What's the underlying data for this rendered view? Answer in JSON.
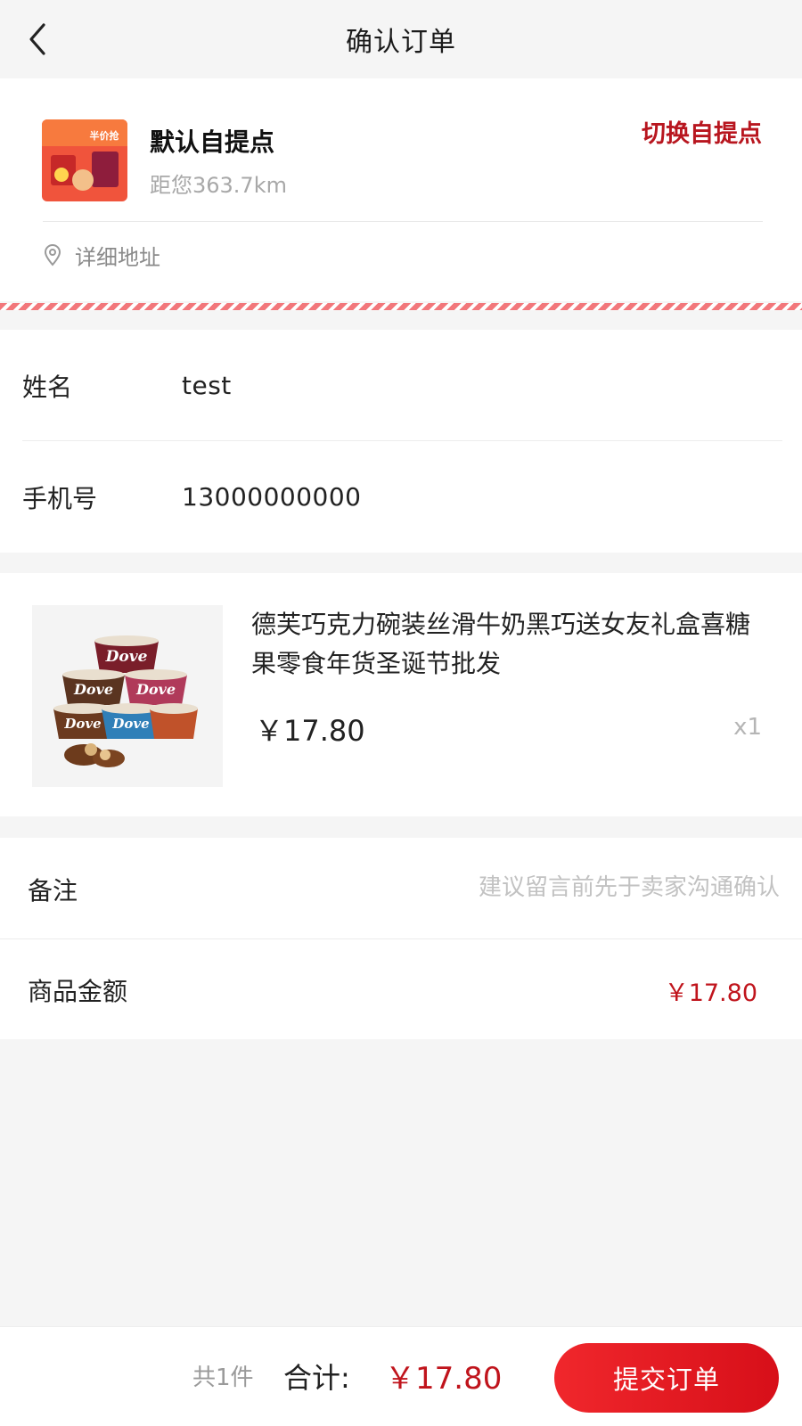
{
  "header": {
    "title": "确认订单",
    "back_icon": "chevron-left-icon"
  },
  "pickup": {
    "store_name": "默认自提点",
    "distance": "距您363.7km",
    "switch_label": "切换自提点",
    "address_icon": "location-pin-icon",
    "address_label": "详细地址",
    "thumb_text": "半价抢"
  },
  "contact": {
    "name_label": "姓名",
    "name_value": "test",
    "phone_label": "手机号",
    "phone_value": "13000000000"
  },
  "product": {
    "title": "德芙巧克力碗装丝滑牛奶黑巧送女友礼盒喜糖果零食年货圣诞节批发",
    "price": "￥17.80",
    "quantity": "x1",
    "brand_text": "Dove"
  },
  "remark": {
    "label": "备注",
    "placeholder": "建议留言前先于卖家沟通确认"
  },
  "amount": {
    "label": "商品金额",
    "value": "￥17.80"
  },
  "footer": {
    "count_text": "共1件",
    "total_label": "合计:",
    "total_value": "￥17.80",
    "submit_label": "提交订单"
  },
  "colors": {
    "accent": "#c0141c",
    "button": "#e61f24",
    "background": "#f5f5f5"
  }
}
